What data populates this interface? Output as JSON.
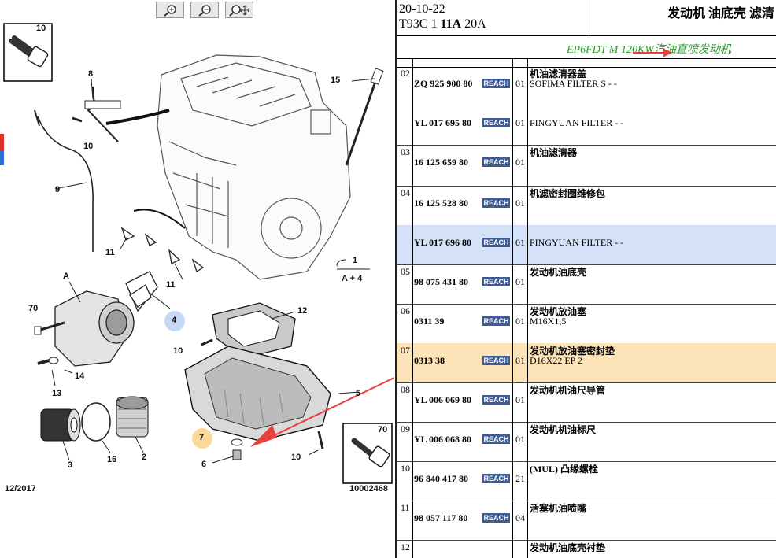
{
  "toolbar": {
    "zoom_in_icon": "zoom-in",
    "zoom_out_icon": "zoom-out",
    "zoom_pan_icon": "zoom-pan"
  },
  "diagram": {
    "date_code": "12/2017",
    "plate_number": "10002468",
    "inset_top_label": "10",
    "inset_bottom_label": "70",
    "callouts": [
      "1",
      "2",
      "3",
      "4",
      "5",
      "6",
      "7",
      "8",
      "9",
      "10",
      "11",
      "12",
      "13",
      "14",
      "15",
      "16",
      "70",
      "A"
    ],
    "engine_ref_number": "1",
    "engine_ref_sub": "A + 4"
  },
  "header": {
    "date": "20-10-22",
    "code_prefix": "T93C 1",
    "code_bold": "11A",
    "code_suffix": "20A",
    "title": "发动机 油底壳 滤清"
  },
  "engine_note": "EP6FDT M 120KW汽油直喷发动机",
  "reach_label": "REACH",
  "parts": [
    {
      "pos": "02",
      "ref": "ZQ 925 900 80",
      "qty": "01",
      "name": "机油滤清器盖",
      "detail": "SOFIMA FILTER S - -"
    },
    {
      "pos": "",
      "ref": "YL 017 695 80",
      "qty": "01",
      "name": "",
      "detail": "PINGYUAN FILTER - -"
    },
    {
      "pos": "03",
      "ref": "16 125 659 80",
      "qty": "01",
      "name": "机油滤清器",
      "detail": ""
    },
    {
      "pos": "04",
      "ref": "16 125 528 80",
      "qty": "01",
      "name": "机滤密封圈维修包",
      "detail": ""
    },
    {
      "pos": "",
      "ref": "YL 017 696 80",
      "qty": "01",
      "name": "",
      "detail": "PINGYUAN FILTER - -"
    },
    {
      "pos": "05",
      "ref": "98 075 431 80",
      "qty": "01",
      "name": "发动机油底壳",
      "detail": ""
    },
    {
      "pos": "06",
      "ref": "0311 39",
      "qty": "01",
      "name": "发动机放油塞",
      "detail": "M16X1,5"
    },
    {
      "pos": "07",
      "ref": "0313 38",
      "qty": "01",
      "name": "发动机放油塞密封垫",
      "detail": "D16X22 EP 2"
    },
    {
      "pos": "08",
      "ref": "YL 006 069 80",
      "qty": "01",
      "name": "发动机机油尺导管",
      "detail": ""
    },
    {
      "pos": "09",
      "ref": "YL 006 068 80",
      "qty": "01",
      "name": "发动机机油标尺",
      "detail": ""
    },
    {
      "pos": "10",
      "ref": "96 840 417 80",
      "qty": "21",
      "name": "(MUL) 凸缘螺栓",
      "detail": ""
    },
    {
      "pos": "11",
      "ref": "98 057 117 80",
      "qty": "04",
      "name": "活塞机油喷嘴",
      "detail": ""
    },
    {
      "pos": "12",
      "ref": "",
      "qty": "",
      "name": "发动机油底壳衬垫",
      "detail": ""
    }
  ],
  "colors": {
    "reach_badge": "#3d5b95",
    "highlight_blue": "#d5e1f7",
    "highlight_orange": "#fde3b8",
    "engine_note": "#2e9a2e",
    "arrow_red": "#e8403c"
  }
}
